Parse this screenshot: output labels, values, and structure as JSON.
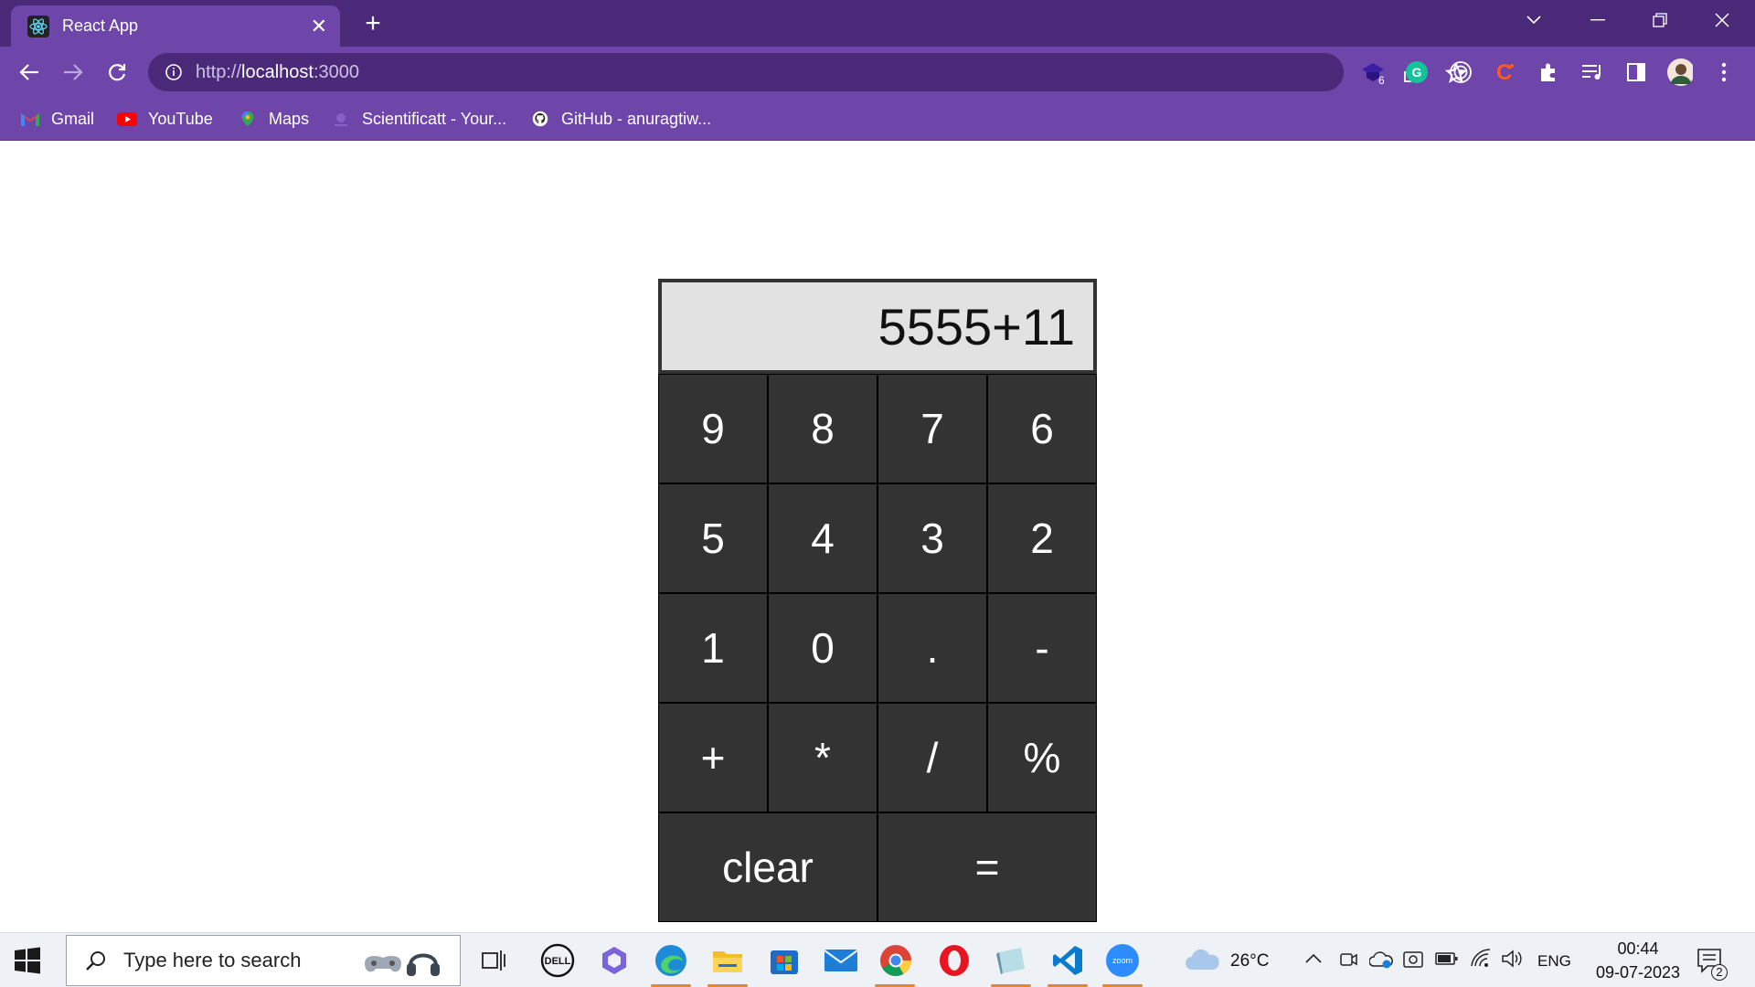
{
  "browser": {
    "tab_title": "React App",
    "url_prefix": "http://",
    "url_host": "localhost",
    "url_port": ":3000",
    "extension_badge": "6",
    "bookmarks": [
      {
        "label": "Gmail",
        "icon": "gmail-icon"
      },
      {
        "label": "YouTube",
        "icon": "youtube-icon"
      },
      {
        "label": "Maps",
        "icon": "maps-icon"
      },
      {
        "label": "Scientificatt - Your...",
        "icon": "scientificatt-icon"
      },
      {
        "label": "GitHub - anuragtiw...",
        "icon": "github-icon"
      }
    ],
    "colors": {
      "frame": "#4a2a78",
      "toolbar": "#6e45a8"
    }
  },
  "calculator": {
    "display": "5555+11",
    "keys": [
      "9",
      "8",
      "7",
      "6",
      "5",
      "4",
      "3",
      "2",
      "1",
      "0",
      ".",
      "-",
      "+",
      "*",
      "/",
      "%"
    ],
    "clear_label": "clear",
    "equals_label": "=",
    "colors": {
      "key_bg": "#333333",
      "display_bg": "#e2e2e2"
    }
  },
  "taskbar": {
    "search_placeholder": "Type here to search",
    "apps": [
      "task-view-icon",
      "dell-icon",
      "copilot-icon",
      "edge-icon",
      "file-explorer-icon",
      "store-icon",
      "mail-icon",
      "chrome-icon",
      "opera-icon",
      "notepad-icon",
      "vscode-icon",
      "zoom-icon"
    ],
    "weather": "26°C",
    "language": "ENG",
    "time": "00:44",
    "date": "09-07-2023",
    "notification_count": "2"
  }
}
